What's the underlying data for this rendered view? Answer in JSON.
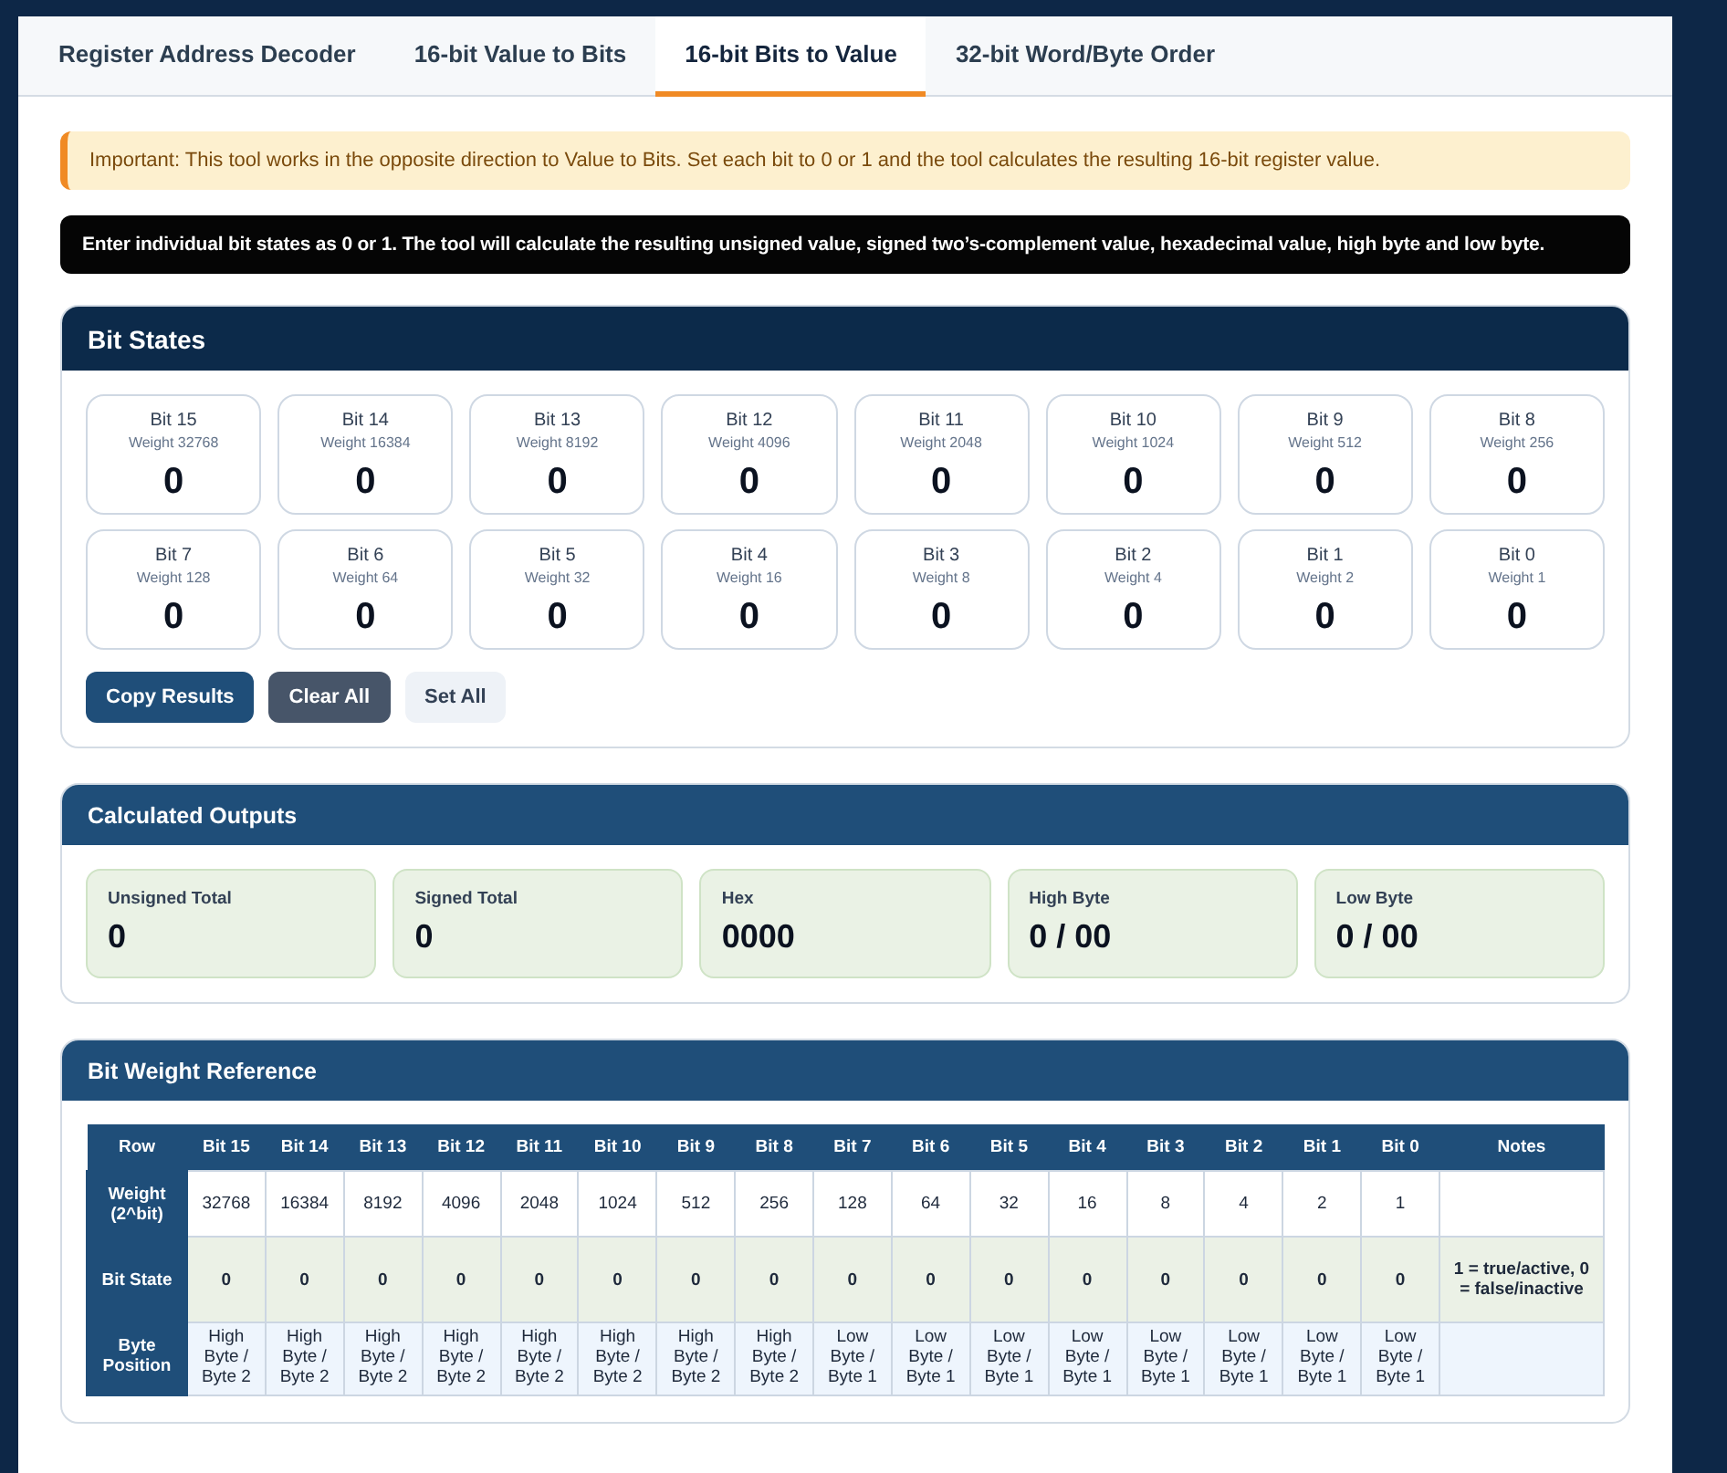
{
  "tabs": [
    {
      "label": "Register Address Decoder",
      "selected": false
    },
    {
      "label": "16-bit Value to Bits",
      "selected": false
    },
    {
      "label": "16-bit Bits to Value",
      "selected": true
    },
    {
      "label": "32-bit Word/Byte Order",
      "selected": false
    }
  ],
  "notice": "Important: This tool works in the opposite direction to Value to Bits. Set each bit to 0 or 1 and the tool calculates the resulting 16-bit register value.",
  "instruction": "Enter individual bit states as 0 or 1. The tool will calculate the resulting unsigned value, signed two’s-complement value, hexadecimal value, high byte and low byte.",
  "bit_states": {
    "title": "Bit States",
    "bits": [
      {
        "label": "Bit 15",
        "weight": "Weight 32768",
        "value": "0"
      },
      {
        "label": "Bit 14",
        "weight": "Weight 16384",
        "value": "0"
      },
      {
        "label": "Bit 13",
        "weight": "Weight 8192",
        "value": "0"
      },
      {
        "label": "Bit 12",
        "weight": "Weight 4096",
        "value": "0"
      },
      {
        "label": "Bit 11",
        "weight": "Weight 2048",
        "value": "0"
      },
      {
        "label": "Bit 10",
        "weight": "Weight 1024",
        "value": "0"
      },
      {
        "label": "Bit 9",
        "weight": "Weight 512",
        "value": "0"
      },
      {
        "label": "Bit 8",
        "weight": "Weight 256",
        "value": "0"
      },
      {
        "label": "Bit 7",
        "weight": "Weight 128",
        "value": "0"
      },
      {
        "label": "Bit 6",
        "weight": "Weight 64",
        "value": "0"
      },
      {
        "label": "Bit 5",
        "weight": "Weight 32",
        "value": "0"
      },
      {
        "label": "Bit 4",
        "weight": "Weight 16",
        "value": "0"
      },
      {
        "label": "Bit 3",
        "weight": "Weight 8",
        "value": "0"
      },
      {
        "label": "Bit 2",
        "weight": "Weight 4",
        "value": "0"
      },
      {
        "label": "Bit 1",
        "weight": "Weight 2",
        "value": "0"
      },
      {
        "label": "Bit 0",
        "weight": "Weight 1",
        "value": "0"
      }
    ],
    "buttons": [
      {
        "label": "Copy Results",
        "kind": "primary"
      },
      {
        "label": "Clear All",
        "kind": "dark"
      },
      {
        "label": "Set All",
        "kind": "light"
      }
    ]
  },
  "outputs": {
    "title": "Calculated Outputs",
    "items": [
      {
        "label": "Unsigned Total",
        "value": "0"
      },
      {
        "label": "Signed Total",
        "value": "0"
      },
      {
        "label": "Hex",
        "value": "0000"
      },
      {
        "label": "High Byte",
        "value": "0 / 00"
      },
      {
        "label": "Low Byte",
        "value": "0 / 00"
      }
    ]
  },
  "reference": {
    "title": "Bit Weight Reference",
    "columns": [
      "Row",
      "Bit 15",
      "Bit 14",
      "Bit 13",
      "Bit 12",
      "Bit 11",
      "Bit 10",
      "Bit 9",
      "Bit 8",
      "Bit 7",
      "Bit 6",
      "Bit 5",
      "Bit 4",
      "Bit 3",
      "Bit 2",
      "Bit 1",
      "Bit 0",
      "Notes"
    ],
    "rows": [
      {
        "kind": "weight",
        "cells": [
          "Weight (2^bit)",
          "32768",
          "16384",
          "8192",
          "4096",
          "2048",
          "1024",
          "512",
          "256",
          "128",
          "64",
          "32",
          "16",
          "8",
          "4",
          "2",
          "1",
          ""
        ]
      },
      {
        "kind": "state",
        "cells": [
          "Bit State",
          "0",
          "0",
          "0",
          "0",
          "0",
          "0",
          "0",
          "0",
          "0",
          "0",
          "0",
          "0",
          "0",
          "0",
          "0",
          "0",
          "1 = true/active, 0 = false/inactive"
        ]
      },
      {
        "kind": "position",
        "cells": [
          "Byte Position",
          "High Byte / Byte 2",
          "High Byte / Byte 2",
          "High Byte / Byte 2",
          "High Byte / Byte 2",
          "High Byte / Byte 2",
          "High Byte / Byte 2",
          "High Byte / Byte 2",
          "High Byte / Byte 2",
          "Low Byte / Byte 1",
          "Low Byte / Byte 1",
          "Low Byte / Byte 1",
          "Low Byte / Byte 1",
          "Low Byte / Byte 1",
          "Low Byte / Byte 1",
          "Low Byte / Byte 1",
          "Low Byte / Byte 1",
          ""
        ]
      }
    ]
  }
}
